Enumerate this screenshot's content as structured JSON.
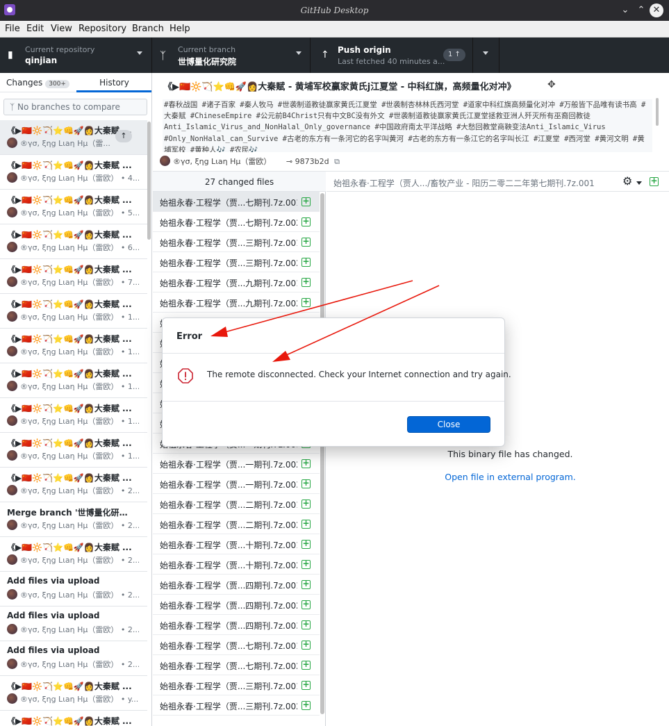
{
  "window": {
    "title": "GitHub Desktop"
  },
  "menu": [
    "File",
    "Edit",
    "View",
    "Repository",
    "Branch",
    "Help"
  ],
  "toolbar": {
    "repo_label": "Current repository",
    "repo_value": "qinjian",
    "branch_label": "Current branch",
    "branch_value": "世博量化研究院",
    "push_label": "Push origin",
    "push_sub": "Last fetched 40 minutes a...",
    "push_count": "1 ↑"
  },
  "sidebar": {
    "changes_tab": "Changes",
    "changes_count": "300+",
    "history_tab": "History",
    "branch_placeholder": "No branches to compare",
    "commits": [
      {
        "summary": "《▶🇨🇳🔆🏹⭐👊🚀👩大秦赋 ...",
        "meta": "®γσ, ξηg Lιaη Hμ（雷...",
        "selected": true
      },
      {
        "summary": "《▶🇨🇳🔆🏹⭐👊🚀👩大秦赋 ...",
        "meta": "®γσ, ξηg Lιaη Hμ（雷欧） • 4..."
      },
      {
        "summary": "《▶🇨🇳🔆🏹⭐👊🚀👩大秦赋 ...",
        "meta": "®γσ, ξηg Lιaη Hμ（雷欧） • 5..."
      },
      {
        "summary": "《▶🇨🇳🔆🏹⭐👊🚀👩大秦赋 ...",
        "meta": "®γσ, ξηg Lιaη Hμ（雷欧） • 6..."
      },
      {
        "summary": "《▶🇨🇳🔆🏹⭐👊🚀👩大秦赋 ...",
        "meta": "®γσ, ξηg Lιaη Hμ（雷欧） • 7..."
      },
      {
        "summary": "《▶🇨🇳🔆🏹⭐👊🚀👩大秦赋 ...",
        "meta": "®γσ, ξηg Lιaη Hμ（雷欧） • 1..."
      },
      {
        "summary": "《▶🇨🇳🔆🏹⭐👊🚀👩大秦赋 ...",
        "meta": "®γσ, ξηg Lιaη Hμ（雷欧） • 1..."
      },
      {
        "summary": "《▶🇨🇳🔆🏹⭐👊🚀👩大秦赋 ...",
        "meta": "®γσ, ξηg Lιaη Hμ（雷欧） • 1..."
      },
      {
        "summary": "《▶🇨🇳🔆🏹⭐👊🚀👩大秦赋 ...",
        "meta": "®γσ, ξηg Lιaη Hμ（雷欧） • 1..."
      },
      {
        "summary": "《▶🇨🇳🔆🏹⭐👊🚀👩大秦赋 ...",
        "meta": "®γσ, ξηg Lιaη Hμ（雷欧） • 1..."
      },
      {
        "summary": "《▶🇨🇳🔆🏹⭐👊🚀👩大秦赋 ...",
        "meta": "®γσ, ξηg Lιaη Hμ（雷欧） • 2..."
      },
      {
        "summary": "Merge branch '世博量化研究院...",
        "meta": "®γσ, ξηg Lιaη Hμ（雷欧） • 2..."
      },
      {
        "summary": "《▶🇨🇳🔆🏹⭐👊🚀👩大秦赋 ...",
        "meta": "®γσ, ξηg Lιaη Hμ（雷欧） • 2..."
      },
      {
        "summary": "Add files via upload",
        "meta": "®γσ, ξηg Lιaη Hμ（雷欧） • 2..."
      },
      {
        "summary": "Add files via upload",
        "meta": "®γσ, ξηg Lιaη Hμ（雷欧） • 2..."
      },
      {
        "summary": "Add files via upload",
        "meta": "®γσ, ξηg Lιaη Hμ（雷欧） • 2..."
      },
      {
        "summary": "《▶🇨🇳🔆🏹⭐👊🚀👩大秦赋 ...",
        "meta": "®γσ, ξηg Lιaη Hμ（雷欧） • y..."
      },
      {
        "summary": "《▶🇨🇳🔆🏹⭐👊🚀👩大秦赋 ...",
        "meta": ""
      }
    ]
  },
  "commit": {
    "title": "《▶🇨🇳🔆🏹⭐👊🚀👩大秦赋 - 黄埔军校赢家黄氏j江夏堂 - 中科红旗，高频量化对冲》",
    "description": "#春秋战国 #诸子百家 #秦人牧马 #世袭制道教徒赢家黄氏江夏堂 #世袭制杏林林氏西河堂 #道家中科红旗高频量化对冲 #万般皆下品唯有读书高 #大秦赋 #ChineseEmpire #公元前B4Christ只有中文BC没有外文 #世袭制道教徒赢家黄氏江夏堂拯救亚洲人歼灭所有巫裔回教徒Anti_Islamic_Virus_and_NonHalal_Only_governance #中国政府南太平洋战略 #大愁回教堂商鞅变法Anti_Islamic_Virus #Only_NonHalal_can_Survive #古老的东方有一条河它的名字叫黄河 #古老的东方有一条江它的名字叫长江 #江夏堂 #西河堂 #黄河文明 #黄埔军校 #黄种人🎶 #农民🎶",
    "author": "®γσ, ξηg Lιaη Hμ（雷欧）",
    "sha": "9873b2d"
  },
  "files": {
    "header": "27 changed files",
    "items": [
      "始祖永春·工程学（贾...七期刊.7z.001",
      "始祖永春·工程学（贾...七期刊.7z.002",
      "始祖永春·工程学（贾...三期刊.7z.001",
      "始祖永春·工程学（贾...三期刊.7z.002",
      "始祖永春·工程学（贾...九期刊.7z.001",
      "始祖永春·工程学（贾...九期刊.7z.002",
      "始祖永春·工程学（贾...",
      "始祖永春·工程学（贾...",
      "始祖永春·工程学（贾...",
      "始祖永春·工程学（贾...",
      "始祖永春·工程学（贾...",
      "始祖永春·工程学（贾...",
      "始祖永春·工程学（贾...一期刊.7z.001",
      "始祖永春·工程学（贾...一期刊.7z.002",
      "始祖永春·工程学（贾...一期刊.7z.003",
      "始祖永春·工程学（贾...二期刊.7z.001",
      "始祖永春·工程学（贾...二期刊.7z.002",
      "始祖永春·工程学（贾...十期刊.7z.001",
      "始祖永春·工程学（贾...十期刊.7z.002",
      "始祖永春·工程学（贾...四期刊.7z.001",
      "始祖永春·工程学（贾...四期刊.7z.002",
      "始祖永春·工程学（贾...四期刊.7z.003",
      "始祖永春·工程学（贾...七期刊.7z.001",
      "始祖永春·工程学（贾...七期刊.7z.002",
      "始祖永春·工程学（贾...三期刊.7z.001",
      "始祖永春·工程学（贾...三期刊.7z.002"
    ]
  },
  "diff": {
    "path": "始祖永春·工程学（贾人.../畜牧产业 - 阳历二零二二年第七期刊.7z.001",
    "binary_text": "This binary file has changed.",
    "open_link": "Open file in external program."
  },
  "dialog": {
    "title": "Error",
    "message": "The remote disconnected. Check your Internet connection and try again.",
    "close_label": "Close"
  },
  "colors": {
    "accent": "#0366d6",
    "toolbar": "#24292e",
    "added": "#28a745",
    "error": "#cb2431",
    "arrow": "#e8180c"
  }
}
